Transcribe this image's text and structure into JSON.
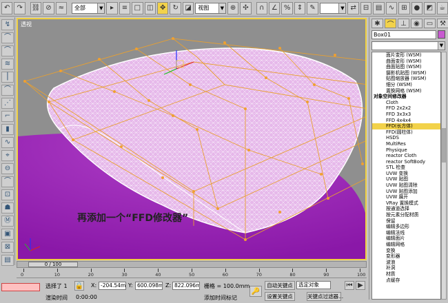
{
  "toolbar": {
    "selection_filter": "全部",
    "ref_coord": "视图"
  },
  "viewport": {
    "label": "透视",
    "caption": "再添加一个“FFD修改器”"
  },
  "panel": {
    "object_name": "Box01",
    "object_color": "#c75ad0",
    "modifiers": [
      {
        "label": "面片变形 (WSM)",
        "type": "ind"
      },
      {
        "label": "曲面变形 (WSM)",
        "type": "ind"
      },
      {
        "label": "曲面贴图 (WSM)",
        "type": "ind"
      },
      {
        "label": "摄影机贴图 (WSM)",
        "type": "ind"
      },
      {
        "label": "贴图缩放器 (WSM)",
        "type": "ind"
      },
      {
        "label": "细分 (WSM)",
        "type": "ind"
      },
      {
        "label": "置换网格 (WSM)",
        "type": "ind"
      },
      {
        "label": "对象空间修改器",
        "type": "hdr"
      },
      {
        "label": "Cloth",
        "type": "ind"
      },
      {
        "label": "FFD 2x2x2",
        "type": "ind"
      },
      {
        "label": "FFD 3x3x3",
        "type": "ind"
      },
      {
        "label": "FFD 4x4x4",
        "type": "ind"
      },
      {
        "label": "FFD(长方体)",
        "type": "sel"
      },
      {
        "label": "FFD(圆柱体)",
        "type": "ind"
      },
      {
        "label": "HSDS",
        "type": "ind"
      },
      {
        "label": "MultiRes",
        "type": "ind"
      },
      {
        "label": "Physique",
        "type": "ind"
      },
      {
        "label": "reactor Cloth",
        "type": "ind"
      },
      {
        "label": "reactor SoftBody",
        "type": "ind"
      },
      {
        "label": "STL 检查",
        "type": "ind"
      },
      {
        "label": "UVW 变换",
        "type": "ind"
      },
      {
        "label": "UVW 贴图",
        "type": "ind"
      },
      {
        "label": "UVW 贴图清除",
        "type": "ind"
      },
      {
        "label": "UVW 贴图添加",
        "type": "ind"
      },
      {
        "label": "UVW 展开",
        "type": "ind"
      },
      {
        "label": "VRay 置换模式",
        "type": "ind"
      },
      {
        "label": "按通道选择",
        "type": "ind"
      },
      {
        "label": "按元素分配材质",
        "type": "ind"
      },
      {
        "label": "保留",
        "type": "ind"
      },
      {
        "label": "编辑多边形",
        "type": "ind"
      },
      {
        "label": "编辑法线",
        "type": "ind"
      },
      {
        "label": "编辑面片",
        "type": "ind"
      },
      {
        "label": "编辑网格",
        "type": "ind"
      },
      {
        "label": "变换",
        "type": "ind"
      },
      {
        "label": "变形器",
        "type": "ind"
      },
      {
        "label": "波浪",
        "type": "ind"
      },
      {
        "label": "补洞",
        "type": "ind"
      },
      {
        "label": "材质",
        "type": "ind"
      },
      {
        "label": "点缓存",
        "type": "ind"
      }
    ]
  },
  "timeline": {
    "frame_display": "0 / 100",
    "ticks": [
      "0",
      "10",
      "20",
      "30",
      "40",
      "50",
      "60",
      "70",
      "80",
      "90",
      "100"
    ]
  },
  "status": {
    "selection": "选择了 1",
    "x_label": "X:",
    "x_value": "-204.54mm",
    "y_label": "Y:",
    "y_value": "600.098mm",
    "z_label": "Z:",
    "z_value": "822.096mm",
    "grid": "栅格 = 100.0mm",
    "render_time_label": "渲染时间",
    "render_time_value": "0:00:00",
    "add_time_tag": "添加时间标记",
    "auto_key": "自动关键点",
    "selected_object": "选定对象",
    "set_key": "设置关键点",
    "key_filter": "关键点过滤器..."
  }
}
